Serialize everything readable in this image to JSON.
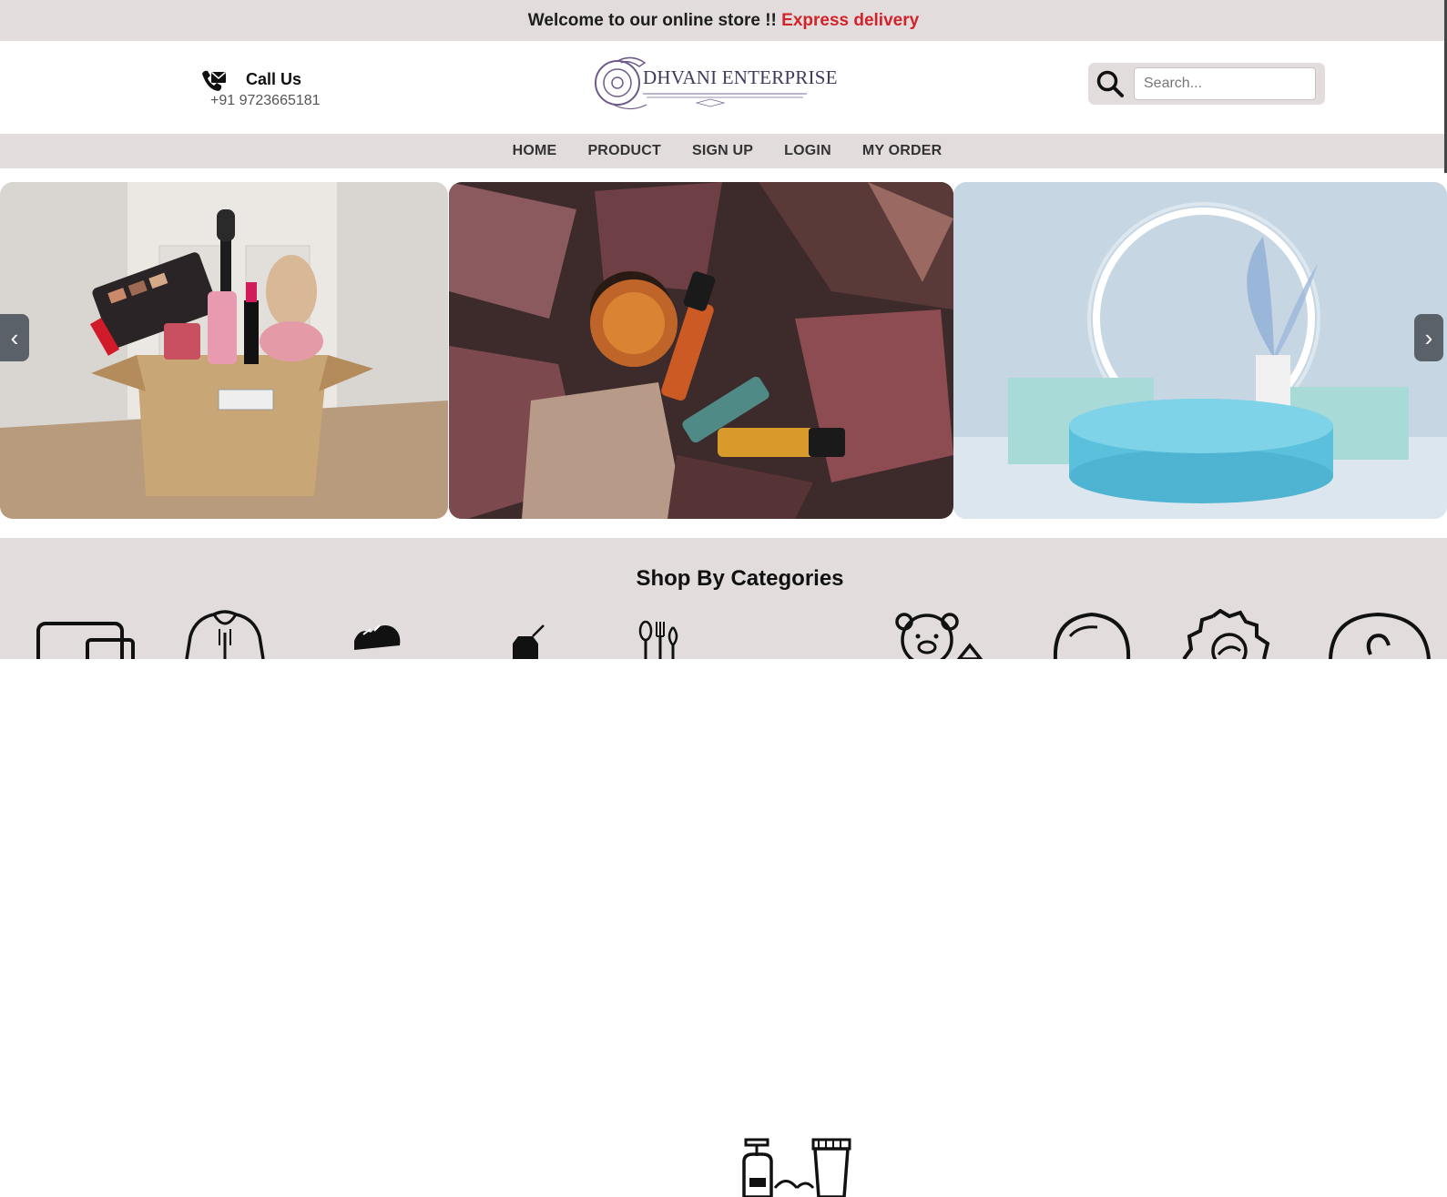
{
  "topbar": {
    "welcome": "Welcome to our online store !! ",
    "highlight": "Express delivery",
    "highlight_color": "#d1232a"
  },
  "header": {
    "call_label": "Call Us",
    "phone": "+91 9723665181",
    "logo_text": "DHVANI ENTERPRISE",
    "search_placeholder": "Search..."
  },
  "nav": {
    "items": [
      "HOME",
      "PRODUCT",
      "SIGN UP",
      "LOGIN",
      "MY ORDER"
    ]
  },
  "slider": {
    "slides": [
      "cosmetics-box-image",
      "autumn-leaves-products-image",
      "podium-display-image"
    ],
    "prev_symbol": "‹",
    "next_symbol": "›"
  },
  "categories": {
    "title": "Shop By Categories",
    "icons": [
      "laptop-icon",
      "hoodie-icon",
      "shoes-icon",
      "blender-icon",
      "kitchen-utensils-icon",
      "cosmetics-icon",
      "toys-icon",
      "baby-icon",
      "gear-icon",
      "more-icon"
    ]
  },
  "colors": {
    "band": "#e2dcdc",
    "accent": "#d1232a",
    "text": "#1d1d1d"
  }
}
